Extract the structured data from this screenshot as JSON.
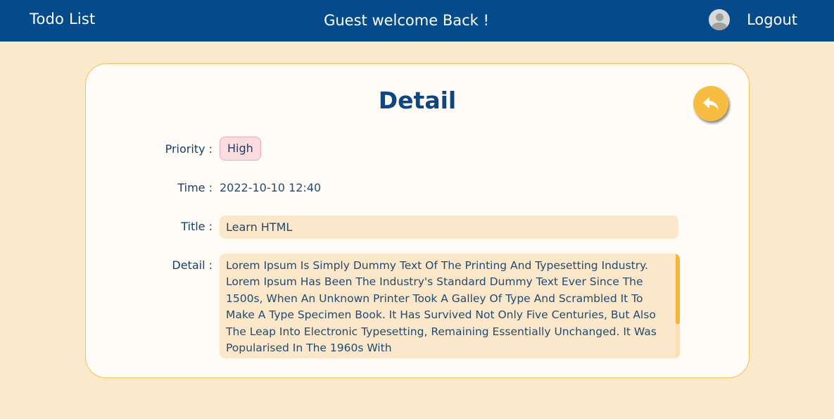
{
  "navbar": {
    "brand": "Todo List",
    "welcome": "Guest welcome Back !",
    "logout_label": "Logout",
    "background_color": "#054a8a"
  },
  "card": {
    "heading": "Detail",
    "back_icon": "reply-arrow-icon",
    "priority_label": "Priority :",
    "priority_value": "High",
    "time_label": "Time :",
    "time_value": "2022-10-10 12:40",
    "title_label": "Title :",
    "title_value": "Learn HTML",
    "detail_label": "Detail :",
    "detail_value": "Lorem Ipsum Is Simply Dummy Text Of The Printing And Typesetting Industry. Lorem Ipsum Has Been The Industry's Standard Dummy Text Ever Since The 1500s, When An Unknown Printer Took A Galley Of Type And Scrambled It To Make A Type Specimen Book. It Has Survived Not Only Five Centuries, But Also The Leap Into Electronic Typesetting, Remaining Essentially Unchanged. It Was Popularised In The 1960s With",
    "accent_color": "#f7bd42",
    "heading_color": "#0d4680"
  }
}
